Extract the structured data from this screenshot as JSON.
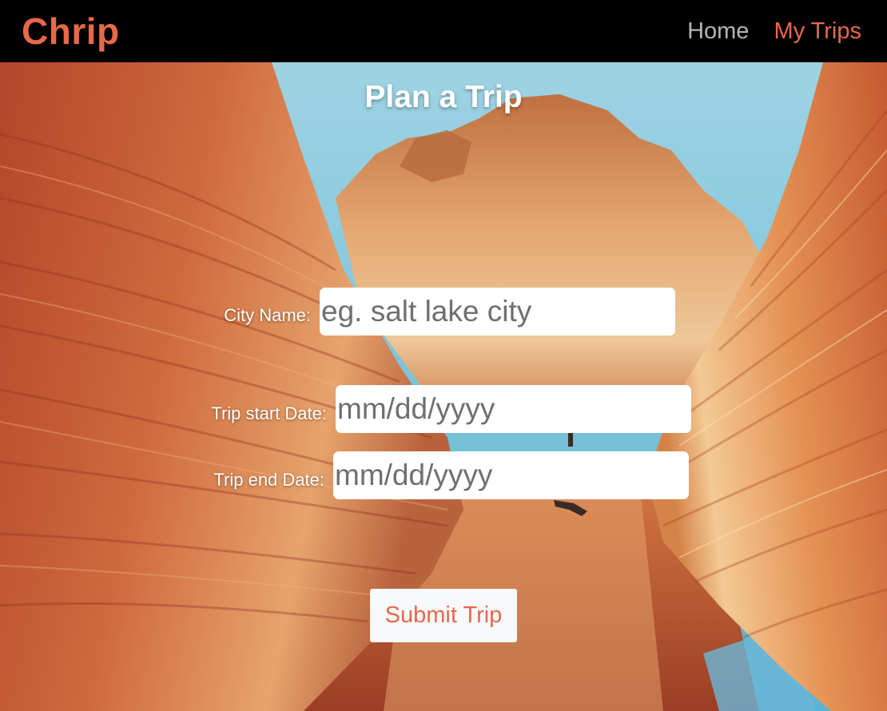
{
  "brand": {
    "name": "Chrip"
  },
  "nav": {
    "home": "Home",
    "my_trips": "My Trips"
  },
  "page": {
    "title": "Plan a Trip"
  },
  "form": {
    "city_label": "City Name:",
    "city_placeholder": "eg. salt lake city",
    "start_label": "Trip start Date:",
    "start_placeholder": "mm/dd/yyyy",
    "end_label": "Trip end Date:",
    "end_placeholder": "mm/dd/yyyy",
    "submit_label": "Submit Trip"
  },
  "colors": {
    "accent": "#e8684a",
    "nav_inactive": "#b5b5b5",
    "navbar_bg": "#000000"
  }
}
